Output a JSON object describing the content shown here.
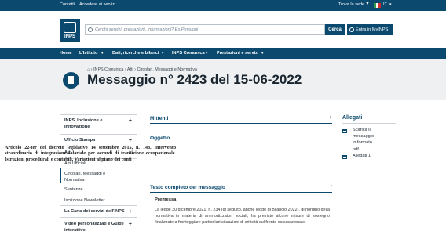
{
  "topbar": {
    "links": [
      "Contatti",
      "Accedere ai servizi"
    ],
    "trova_sede": "Trova la sede",
    "lang": "IT"
  },
  "header": {
    "logo_text": "INPS",
    "search_placeholder": "Cerchi servizi, prestazioni, informazioni? Es.Pensioni",
    "search_button": "Cerca",
    "login_button": "Entra in MyINPS"
  },
  "nav": {
    "items": [
      "Home",
      "L'Istituto",
      "Dati, ricerche e bilanci",
      "INPS Comunica",
      "Prestazioni e servizi"
    ]
  },
  "breadcrumb": [
    "INPS Comunica",
    "Atti",
    "Circolari, Messaggi e Normativa"
  ],
  "page_title": "Messaggio n° 2423 del 15-06-2022",
  "sidebar": {
    "items": [
      {
        "label_1": "INPS, Inclusione e",
        "label_2": "Innovazione",
        "sign": "+"
      },
      {
        "label_1": "Ufficio Stampa",
        "sign": "+"
      },
      {
        "label_1": "Atti",
        "sign": "×"
      },
      {
        "label_1": "Atti Ufficiali"
      },
      {
        "label_1": "Circolari, Messaggi e",
        "label_2": "Normativa"
      },
      {
        "label_1": "Sentenze"
      },
      {
        "label_1": "Iscrizione Newsletter"
      },
      {
        "label_1": "La Carta dei servizi dell'INPS",
        "sign": "+"
      },
      {
        "label_1": "Video personalizzati e Guide",
        "label_2": "interattive",
        "sign": "+"
      }
    ]
  },
  "main": {
    "mittenti": "Mittenti",
    "mittenti_sign": "+",
    "oggetto_title": "Oggetto",
    "oggetto_sign": "-",
    "oggetto_text": "Articolo 22-ter del decreto legislativo 14 settembre 2015, n. 148. Intervento straordinario di integrazione salariale per accordi di transizione occupazionale. Istruzioni procedurali e contabili. Variazioni al piano dei conti",
    "testo_title": "Testo completo del messaggio",
    "testo_sign": "-",
    "premessa": "Premessa",
    "body": "La legge 30 dicembre 2021, n. 234 (di seguito, anche legge di Bilancio 2022), di riordino della normativa in materia di ammortizzatori sociali, ha previsto alcune misure di sostegno finalizzate a fronteggiare particolari situazioni di criticità sul fronte occupazionale."
  },
  "allegati": {
    "title": "Allegati",
    "items": [
      "Scarica il",
      "messaggio",
      "in formato",
      "pdf",
      "Allegati 1"
    ]
  },
  "colors": {
    "brand": "#0b4a6e",
    "band": "#eef0f2"
  }
}
